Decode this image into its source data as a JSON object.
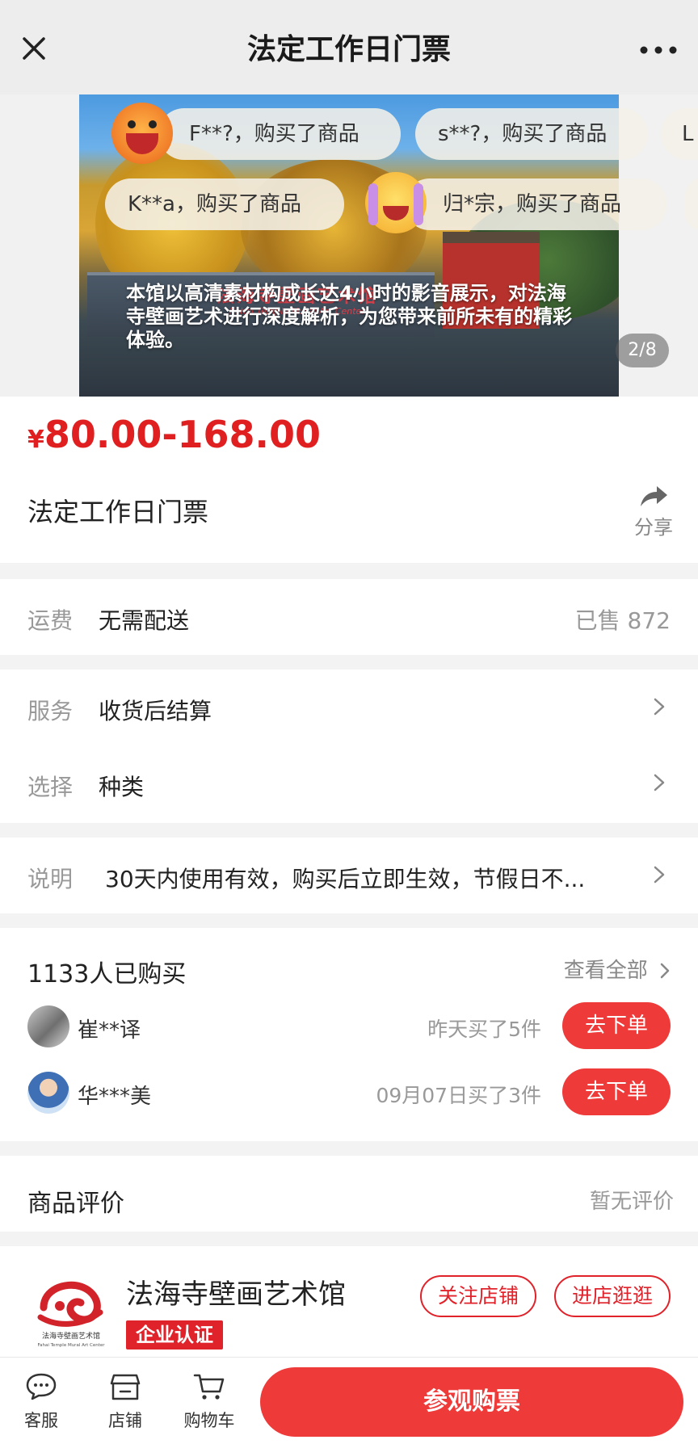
{
  "nav": {
    "title": "法定工作日门票",
    "close_icon": "close-icon",
    "more_icon": "more-dots-icon"
  },
  "banner": {
    "bubbles": [
      "F**?，购买了商品",
      "s**?，购买了商品",
      "K**a，购买了商品",
      "归*宗，购买了商品",
      "L"
    ],
    "wall_text": "法海寺壁画艺术馆",
    "wall_subtext": "Fahai Temple Mural Art Center",
    "caption": "本馆以高清素材构成长达4小时的影音展示，对法海寺壁画艺术进行深度解析，为您带来前所未有的精彩体验。",
    "pager": "2/8"
  },
  "price": {
    "currency": "¥",
    "range": "80.00-168.00",
    "color": "#e02020"
  },
  "product": {
    "title": "法定工作日门票",
    "share_label": "分享"
  },
  "shipping": {
    "key": "运费",
    "value": "无需配送",
    "sold": "已售 872"
  },
  "service": {
    "key": "服务",
    "value": "收货后结算"
  },
  "select": {
    "key": "选择",
    "value": "种类"
  },
  "note": {
    "key": "说明",
    "value": "30天内使用有效，购买后立即生效，节假日不..."
  },
  "buyers": {
    "title": "1133人已购买",
    "see_all": "查看全部",
    "list": [
      {
        "name": "崔**译",
        "when": "昨天买了5件",
        "button": "去下单"
      },
      {
        "name": "华***美",
        "when": "09月07日买了3件",
        "button": "去下单"
      }
    ]
  },
  "reviews": {
    "title": "商品评价",
    "status": "暂无评价"
  },
  "shop": {
    "name": "法海寺壁画艺术馆",
    "cert": "企业认证",
    "follow": "关注店铺",
    "visit": "进店逛逛",
    "logo_text": "法海寺壁画艺术馆",
    "logo_subtext": "Fahai Temple Mural Art Center"
  },
  "bottom": {
    "tabs": [
      {
        "label": "客服",
        "icon": "customer-service-icon"
      },
      {
        "label": "店铺",
        "icon": "store-icon"
      },
      {
        "label": "购物车",
        "icon": "cart-icon"
      }
    ],
    "buy": "参观购票",
    "accent": "#ef3a3a"
  }
}
